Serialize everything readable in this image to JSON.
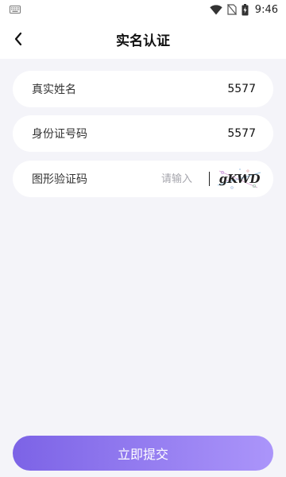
{
  "status_bar": {
    "time": "9:46",
    "icons": [
      "keyboard-icon",
      "wifi-icon",
      "no-sim-icon",
      "battery-charging-icon"
    ]
  },
  "nav": {
    "back_icon": "chevron-left-icon",
    "title": "实名认证"
  },
  "form": {
    "name": {
      "label": "真实姓名",
      "value": "5577"
    },
    "id_number": {
      "label": "身份证号码",
      "value": "5577"
    },
    "captcha": {
      "label": "图形验证码",
      "placeholder": "请输入",
      "value": "",
      "image_text": "gKWD"
    }
  },
  "submit": {
    "label": "立即提交"
  },
  "colors": {
    "page_bg": "#f4f4f9",
    "button_gradient_start": "#7c63e6",
    "button_gradient_end": "#ab95fa"
  }
}
